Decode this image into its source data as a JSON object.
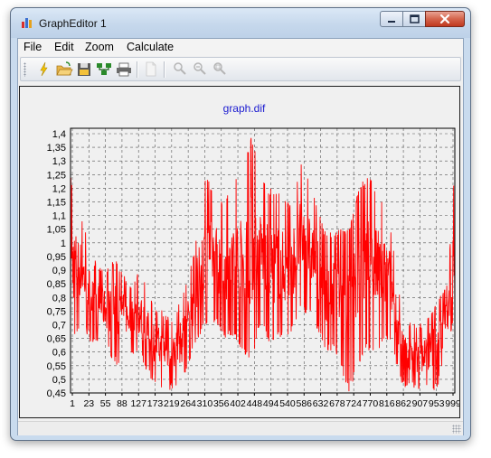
{
  "window": {
    "title": "GraphEditor 1"
  },
  "menu": {
    "items": [
      "File",
      "Edit",
      "Zoom",
      "Calculate"
    ]
  },
  "toolbar": {
    "buttons": [
      {
        "icon": "lightning-icon"
      },
      {
        "icon": "open-folder-icon"
      },
      {
        "icon": "save-icon"
      },
      {
        "icon": "network-icon"
      },
      {
        "icon": "print-icon"
      },
      {
        "icon": "page-icon"
      },
      {
        "icon": "zoom-icon"
      },
      {
        "icon": "zoom-out-icon"
      },
      {
        "icon": "zoom-fit-icon"
      }
    ]
  },
  "chart_data": {
    "type": "line",
    "title": "graph.dif",
    "xlabel": "",
    "ylabel": "",
    "ylim": [
      0.45,
      1.42
    ],
    "yticks": [
      "1,4",
      "1,35",
      "1,3",
      "1,25",
      "1,2",
      "1,15",
      "1,1",
      "1,05",
      "1",
      "0,95",
      "0,9",
      "0,85",
      "0,8",
      "0,75",
      "0,7",
      "0,65",
      "0,6",
      "0,55",
      "0,5",
      "0,45"
    ],
    "xticks": [
      "1",
      "23",
      "55",
      "88",
      "127",
      "173",
      "219",
      "264",
      "310",
      "356",
      "402",
      "448",
      "494",
      "540",
      "586",
      "632",
      "678",
      "724",
      "770",
      "816",
      "862",
      "907",
      "953",
      "999"
    ],
    "grid": true,
    "series_color": "#ff0000",
    "series": [
      {
        "x_range": [
          1,
          999
        ],
        "envelope": [
          [
            1,
            0.62,
            1.25
          ],
          [
            30,
            0.7,
            1.1
          ],
          [
            60,
            0.62,
            0.95
          ],
          [
            90,
            0.62,
            0.9
          ],
          [
            120,
            0.55,
            0.95
          ],
          [
            150,
            0.6,
            0.85
          ],
          [
            180,
            0.58,
            0.9
          ],
          [
            210,
            0.5,
            0.8
          ],
          [
            240,
            0.46,
            0.75
          ],
          [
            264,
            0.46,
            0.72
          ],
          [
            290,
            0.48,
            0.8
          ],
          [
            320,
            0.6,
            0.95
          ],
          [
            350,
            0.7,
            1.25
          ],
          [
            380,
            0.7,
            1.2
          ],
          [
            402,
            0.65,
            1.15
          ],
          [
            430,
            0.65,
            1.25
          ],
          [
            448,
            0.6,
            1.25
          ],
          [
            470,
            0.55,
            1.4
          ],
          [
            494,
            0.7,
            1.25
          ],
          [
            520,
            0.62,
            1.2
          ],
          [
            540,
            0.65,
            1.2
          ],
          [
            570,
            0.65,
            1.15
          ],
          [
            600,
            0.75,
            1.3
          ],
          [
            632,
            0.72,
            1.2
          ],
          [
            660,
            0.6,
            1.05
          ],
          [
            690,
            0.6,
            1.05
          ],
          [
            724,
            0.45,
            1.05
          ],
          [
            750,
            0.55,
            1.2
          ],
          [
            770,
            0.6,
            1.25
          ],
          [
            800,
            0.6,
            1.2
          ],
          [
            830,
            0.65,
            1.1
          ],
          [
            862,
            0.47,
            0.75
          ],
          [
            890,
            0.46,
            0.7
          ],
          [
            920,
            0.46,
            0.72
          ],
          [
            953,
            0.46,
            0.8
          ],
          [
            980,
            0.6,
            0.85
          ],
          [
            999,
            0.75,
            1.28
          ]
        ]
      }
    ]
  }
}
